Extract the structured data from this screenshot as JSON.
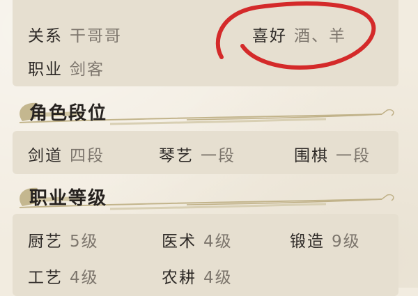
{
  "profile": {
    "relation": {
      "label": "关系",
      "value": "干哥哥"
    },
    "hobby": {
      "label": "喜好",
      "value": "酒、羊"
    },
    "profession": {
      "label": "职业",
      "value": "剑客"
    }
  },
  "sections": {
    "rank_title": "角色段位",
    "career_title": "职业等级"
  },
  "ranks": [
    {
      "label": "剑道",
      "value": "四段"
    },
    {
      "label": "琴艺",
      "value": "一段"
    },
    {
      "label": "围棋",
      "value": "一段"
    }
  ],
  "careers": [
    {
      "label": "厨艺",
      "value": "5级"
    },
    {
      "label": "医术",
      "value": "4级"
    },
    {
      "label": "锻造",
      "value": "9级"
    },
    {
      "label": "工艺",
      "value": "4级"
    },
    {
      "label": "农耕",
      "value": "4级"
    }
  ],
  "colors": {
    "background": "#f2ece0",
    "panel": "#e6dfd0",
    "label_text": "#2e2a27",
    "value_text": "#7d766d",
    "annotation_red": "#d42a2a"
  }
}
